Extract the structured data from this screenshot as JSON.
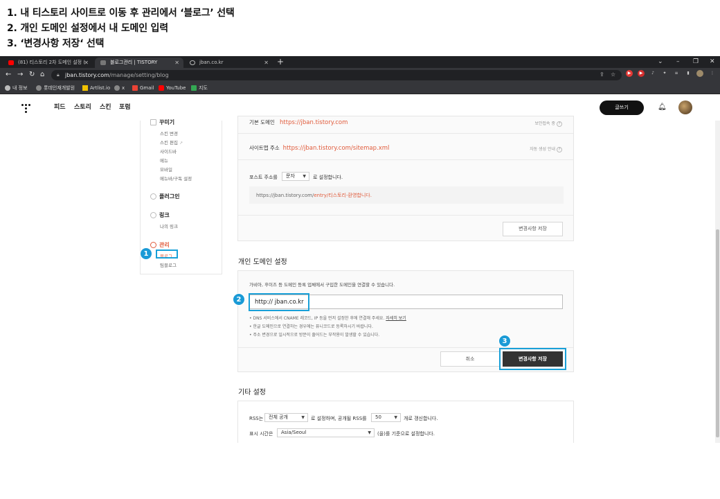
{
  "instructions": [
    "1. 내 티스토리 사이트로 이동 후 관리에서 ‘블로그’ 선택",
    "2. 개인 도메인 설정에서 내 도메인 입력",
    "3. ‘변경사항 저장‘ 선택"
  ],
  "browser": {
    "tabs": [
      {
        "label": "(81) 티스토리 2차 도메인 설정 (",
        "active": false
      },
      {
        "label": "블로그관리 | TISTORY",
        "active": true
      },
      {
        "label": "jban.co.kr",
        "active": false
      }
    ],
    "url_host": "jban.tistory.com",
    "url_path": "/manage/setting/blog",
    "bookmarks": [
      "내 정보",
      "롯데인재개발원",
      "Artlist.io",
      "x",
      "Gmail",
      "YouTube",
      "지도"
    ]
  },
  "header": {
    "nav": [
      "피드",
      "스토리",
      "스킨",
      "포럼"
    ],
    "write_label": "글쓰기"
  },
  "sidebar": {
    "group_customize": "꾸미기",
    "customize_items": [
      "스킨 변경",
      "스킨 편집",
      "사이드바",
      "메뉴",
      "모바일",
      "메뉴바/구독 설정"
    ],
    "plugin": "플러그인",
    "link": "링크",
    "link_items": [
      "나의 링크"
    ],
    "manage": "관리",
    "manage_items": [
      "블로그",
      "팀블로그"
    ]
  },
  "blog_settings": {
    "default_domain_label": "기본 도메인",
    "default_domain": "https://jban.tistory.com",
    "security_note": "보안접속 중",
    "sitemap_label": "사이트맵 주소",
    "sitemap_url": "https://jban.tistory.com/sitemap.xml",
    "sitemap_note": "자동 생성 안내",
    "post_addr_prefix": "포스트 주소를",
    "post_addr_value": "문자",
    "post_addr_suffix": "로 설정합니다.",
    "example_base": "https://jban.tistory.com/",
    "example_path": "entry/티스토리-환영합니다.",
    "save_label": "변경사항 저장"
  },
  "custom_domain": {
    "title": "개인 도메인 설정",
    "desc": "가비아, 후이즈 등 도메인 등록 업체에서 구입한 도메인을 연결할 수 있습니다.",
    "input_value": "http:// jban.co.kr",
    "hint1": "DNS 서비스에서 CNAME 레코드, IP 등을 먼저 설정한 후에 연결해 주세요.",
    "hint1_link": "자세히 보기",
    "hint2": "한글 도메인으로 연결하는 경우에는 퓨니코드로 등록하시기 바랍니다.",
    "hint3": "주소 변경으로 일시적으로 방문이 줄어드는 부작용이 발생할 수 있습니다.",
    "cancel_label": "취소",
    "save_label": "변경사항 저장"
  },
  "other_settings": {
    "title": "기타 설정",
    "rss_prefix": "RSS는",
    "rss_value": "전체 공개",
    "rss_mid": "로 설정하며, 공개될 RSS를",
    "rss_count": "50",
    "rss_suffix": "개로 갱신합니다.",
    "tz_prefix": "표시 시간은",
    "tz_value": "Asia/Seoul",
    "tz_suffix": "(을)를 기준으로 설정합니다."
  },
  "badges": [
    "1",
    "2",
    "3"
  ],
  "colors": {
    "accent_red": "#e05a3a",
    "highlight_blue": "#18a0d8"
  }
}
